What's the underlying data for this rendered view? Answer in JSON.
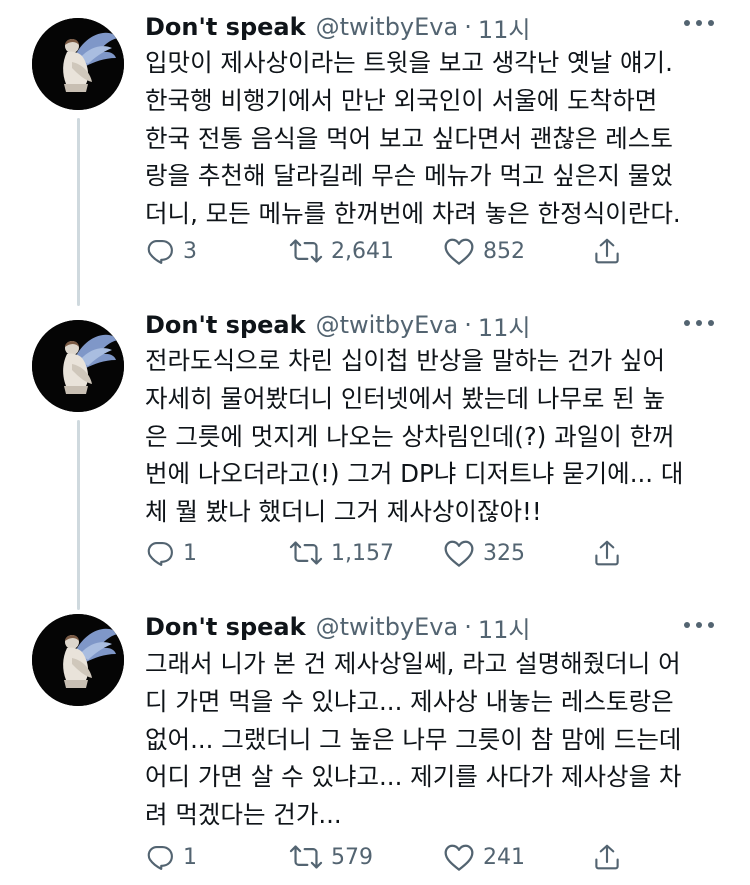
{
  "tweets": [
    {
      "name": "Don't speak",
      "handle": "@twitbyEva",
      "separator": "·",
      "time": "11시",
      "lines": [
        "입맛이 제사상이라는 트윗을 보고 생각난 옛날 얘기.",
        "한국행 비행기에서 만난 외국인이 서울에 도착하면",
        "한국 전통 음식을 먹어 보고 싶다면서 괜찮은 레스토",
        "랑을 추천해 달라길레 무슨 메뉴가 먹고 싶은지 물었",
        "더니, 모든 메뉴를 한꺼번에 차려 놓은 한정식이란다."
      ],
      "replies": "3",
      "retweets": "2,641",
      "likes": "852"
    },
    {
      "name": "Don't speak",
      "handle": "@twitbyEva",
      "separator": "·",
      "time": "11시",
      "lines": [
        "전라도식으로 차린 십이첩 반상을 말하는 건가 싶어",
        "자세히 물어봤더니 인터넷에서 봤는데 나무로 된 높",
        "은 그릇에 멋지게 나오는 상차림인데(?) 과일이 한꺼",
        "번에 나오더라고(!) 그거 DP냐 디저트냐 묻기에... 대",
        "체 뭘 봤나 했더니 그거 제사상이잖아!!"
      ],
      "replies": "1",
      "retweets": "1,157",
      "likes": "325"
    },
    {
      "name": "Don't speak",
      "handle": "@twitbyEva",
      "separator": "·",
      "time": "11시",
      "lines": [
        "그래서 니가 본 건 제사상일쎄, 라고 설명해줬더니 어",
        "디 가면 먹을 수 있냐고... 제사상 내놓는 레스토랑은",
        "없어... 그랬더니 그 높은 나무 그릇이 참 맘에 드는데",
        "어디 가면 살 수 있냐고... 제기를 사다가 제사상을 차",
        "려 먹겠다는 건가..."
      ],
      "replies": "1",
      "retweets": "579",
      "likes": "241"
    }
  ],
  "icons": {
    "avatar": "angel-figure-avatar",
    "more": "more-dots-icon",
    "reply": "reply-bubble-icon",
    "retweet": "retweet-icon",
    "like": "heart-icon",
    "share": "share-icon"
  },
  "colors": {
    "text": "#0f1419",
    "secondary": "#536471",
    "thread_line": "#cfd9de",
    "background": "#ffffff"
  }
}
